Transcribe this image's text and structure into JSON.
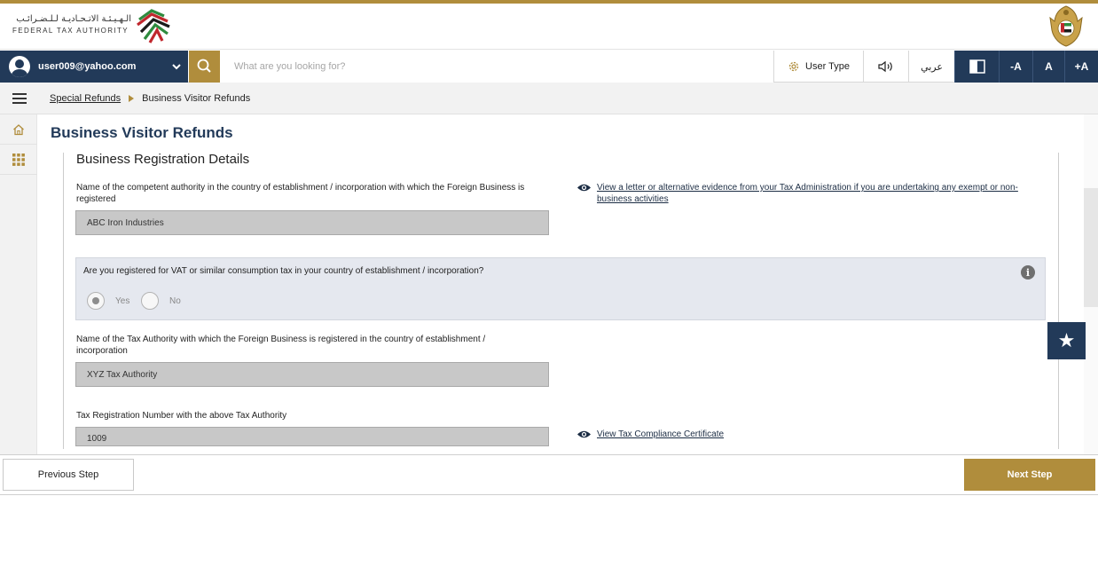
{
  "header": {
    "logo_ar": "الـهـيـئـة الاتـحـاديـة لـلـضـرائـب",
    "logo_en": "FEDERAL TAX AUTHORITY"
  },
  "topbar": {
    "user_email": "user009@yahoo.com",
    "search_placeholder": "What are you looking for?",
    "user_type_label": "User Type",
    "arabic_label": "عربي",
    "font_decrease": "-A",
    "font_normal": "A",
    "font_increase": "+A"
  },
  "breadcrumb": {
    "parent": "Special Refunds",
    "current": "Business Visitor Refunds"
  },
  "page": {
    "title": "Business Visitor Refunds",
    "section_title": "Business Registration Details"
  },
  "form": {
    "authority_label": "Name of the competent authority in the country of establishment / incorporation with which the Foreign Business is registered",
    "authority_value": "ABC Iron Industries",
    "letter_link": "View a letter or alternative evidence from your Tax Administration if you are undertaking any exempt or non-business activities",
    "vat_question": "Are you registered for VAT or similar consumption tax in your country of establishment / incorporation?",
    "vat_yes": "Yes",
    "vat_no": "No",
    "vat_selected": "Yes",
    "tax_authority_label": "Name of the Tax Authority with which the Foreign Business is registered in the country of establishment / incorporation",
    "tax_authority_value": "XYZ Tax Authority",
    "trn_label": "Tax Registration Number with the above Tax Authority",
    "trn_value": "1009",
    "certificate_link": "View Tax Compliance Certificate"
  },
  "footer": {
    "previous_label": "Previous Step",
    "next_label": "Next Step"
  },
  "colors": {
    "navy": "#223a59",
    "gold": "#b08d3c"
  },
  "icons": [
    "user-avatar-icon",
    "chevron-down-icon",
    "search-icon",
    "gear-icon",
    "speaker-icon",
    "contrast-icon",
    "hamburger-icon",
    "home-icon",
    "grid-icon",
    "eye-icon",
    "info-icon",
    "star-icon"
  ]
}
